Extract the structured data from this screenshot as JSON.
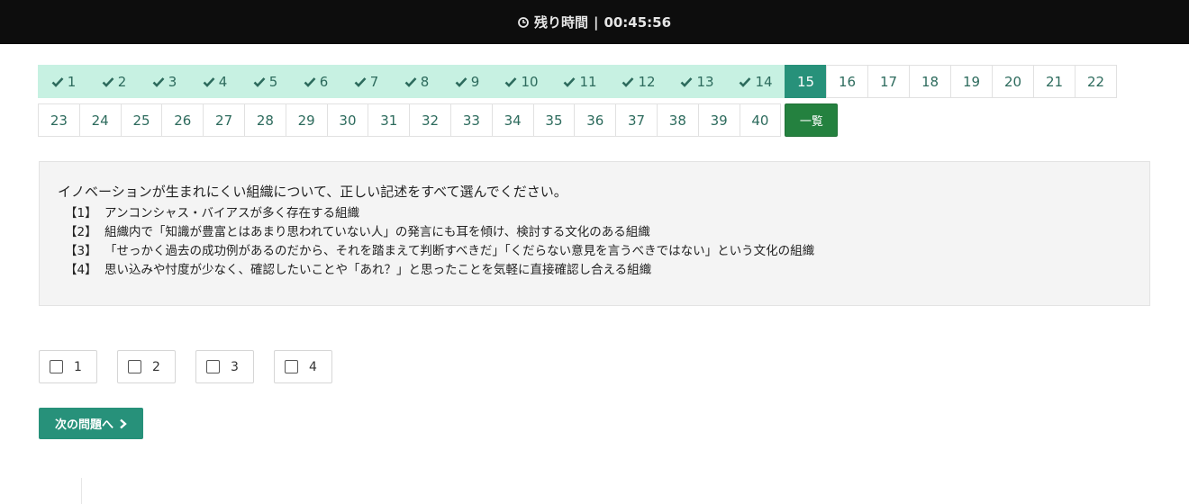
{
  "header": {
    "label": "残り時間",
    "separator": "|",
    "time": "00:45:56",
    "icon": "clock-icon"
  },
  "question_nav": {
    "rows": [
      [
        {
          "label": "1",
          "state": "done"
        },
        {
          "label": "2",
          "state": "done"
        },
        {
          "label": "3",
          "state": "done"
        },
        {
          "label": "4",
          "state": "done"
        },
        {
          "label": "5",
          "state": "done"
        },
        {
          "label": "6",
          "state": "done"
        },
        {
          "label": "7",
          "state": "done"
        },
        {
          "label": "8",
          "state": "done"
        },
        {
          "label": "9",
          "state": "done"
        },
        {
          "label": "10",
          "state": "done"
        },
        {
          "label": "11",
          "state": "done"
        },
        {
          "label": "12",
          "state": "done"
        },
        {
          "label": "13",
          "state": "done"
        },
        {
          "label": "14",
          "state": "done"
        },
        {
          "label": "15",
          "state": "current"
        },
        {
          "label": "16",
          "state": "todo"
        },
        {
          "label": "17",
          "state": "todo"
        },
        {
          "label": "18",
          "state": "todo"
        },
        {
          "label": "19",
          "state": "todo"
        },
        {
          "label": "20",
          "state": "todo"
        },
        {
          "label": "21",
          "state": "todo"
        },
        {
          "label": "22",
          "state": "todo"
        }
      ],
      [
        {
          "label": "23",
          "state": "todo"
        },
        {
          "label": "24",
          "state": "todo"
        },
        {
          "label": "25",
          "state": "todo"
        },
        {
          "label": "26",
          "state": "todo"
        },
        {
          "label": "27",
          "state": "todo"
        },
        {
          "label": "28",
          "state": "todo"
        },
        {
          "label": "29",
          "state": "todo"
        },
        {
          "label": "30",
          "state": "todo"
        },
        {
          "label": "31",
          "state": "todo"
        },
        {
          "label": "32",
          "state": "todo"
        },
        {
          "label": "33",
          "state": "todo"
        },
        {
          "label": "34",
          "state": "todo"
        },
        {
          "label": "35",
          "state": "todo"
        },
        {
          "label": "36",
          "state": "todo"
        },
        {
          "label": "37",
          "state": "todo"
        },
        {
          "label": "38",
          "state": "todo"
        },
        {
          "label": "39",
          "state": "todo"
        },
        {
          "label": "40",
          "state": "todo"
        }
      ]
    ],
    "list_button": "一覧",
    "done_icon": "check-icon"
  },
  "question": {
    "text": "イノベーションが生まれにくい組織について、正しい記述をすべて選んでください。",
    "options": [
      {
        "label": "【1】",
        "text": "アンコンシャス・バイアスが多く存在する組織"
      },
      {
        "label": "【2】",
        "text": "組織内で「知識が豊富とはあまり思われていない人」の発言にも耳を傾け、検討する文化のある組織"
      },
      {
        "label": "【3】",
        "text": "「せっかく過去の成功例があるのだから、それを踏まえて判断すべきだ」「くだらない意見を言うべきではない」という文化の組織"
      },
      {
        "label": "【4】",
        "text": "思い込みや忖度が少なく、確認したいことや「あれ？」と思ったことを気軽に直接確認し合える組織"
      }
    ]
  },
  "answers": [
    {
      "label": "1",
      "checked": false
    },
    {
      "label": "2",
      "checked": false
    },
    {
      "label": "3",
      "checked": false
    },
    {
      "label": "4",
      "checked": false
    }
  ],
  "next_button": {
    "label": "次の問題へ",
    "icon": "chevron-right-icon"
  },
  "colors": {
    "header_bg": "#0d0d0d",
    "done_bg": "#c7f1e2",
    "current_bg": "#27917a",
    "list_button_bg": "#24813f",
    "next_button_bg": "#27917a",
    "question_bg": "#f4f4f4"
  }
}
